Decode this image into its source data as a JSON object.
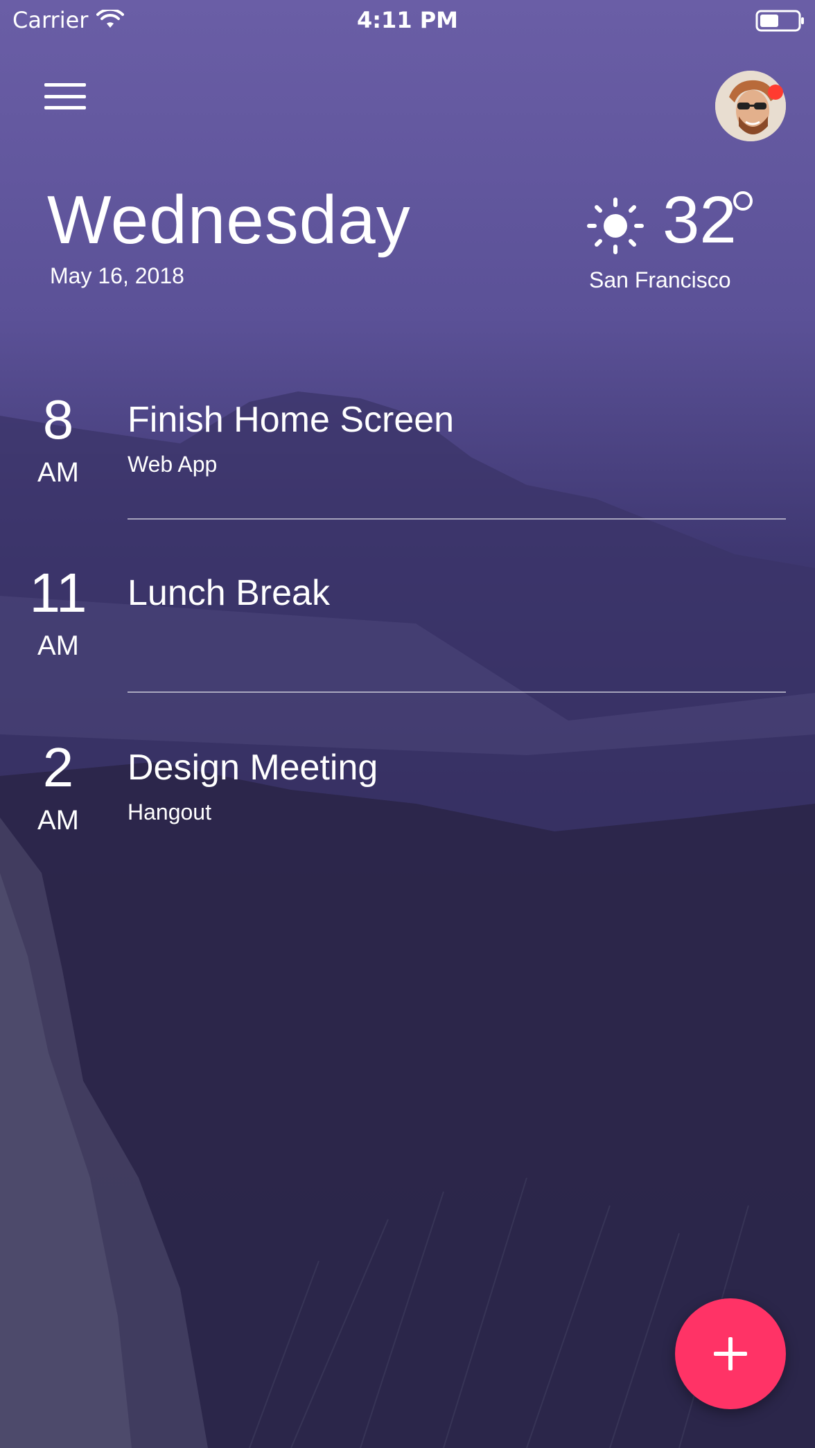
{
  "status_bar": {
    "carrier": "Carrier",
    "time": "4:11 PM",
    "wifi_icon": "wifi-icon",
    "battery_icon": "battery-icon",
    "battery_level": 0.5
  },
  "header": {
    "menu_icon": "hamburger-menu-icon",
    "avatar_icon": "user-avatar",
    "notification_dot_color": "#ff3b30"
  },
  "date": {
    "day": "Wednesday",
    "full_date": "May  16, 2018"
  },
  "weather": {
    "icon": "sun-icon",
    "temperature": "32",
    "city": "San Francisco"
  },
  "events": [
    {
      "hour": "8",
      "ampm": "AM",
      "title": "Finish Home Screen",
      "subtitle": "Web App"
    },
    {
      "hour": "11",
      "ampm": "AM",
      "title": "Lunch Break",
      "subtitle": ""
    },
    {
      "hour": "2",
      "ampm": "AM",
      "title": "Design Meeting",
      "subtitle": "Hangout"
    }
  ],
  "fab": {
    "icon": "plus-icon",
    "color": "#ff3366"
  },
  "colors": {
    "background_top": "#6a5ea6",
    "background_bottom": "#1f1c3b",
    "accent": "#ff3366"
  }
}
